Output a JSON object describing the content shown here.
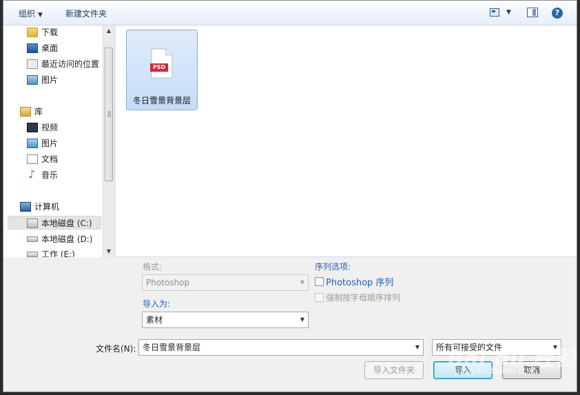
{
  "toolbar": {
    "organize_label": "组织",
    "new_folder_label": "新建文件夹"
  },
  "nav": {
    "items": [
      {
        "label": "下载"
      },
      {
        "label": "桌面"
      },
      {
        "label": "最近访问的位置"
      },
      {
        "label": "图片"
      },
      {
        "label": "库"
      },
      {
        "label": "视频"
      },
      {
        "label": "图片"
      },
      {
        "label": "文档"
      },
      {
        "label": "音乐"
      },
      {
        "label": "计算机"
      },
      {
        "label": "本地磁盘 (C:)"
      },
      {
        "label": "本地磁盘 (D:)"
      },
      {
        "label": "工作 (E:)"
      }
    ]
  },
  "files": {
    "items": [
      {
        "name": "冬日雪景背景层",
        "badge": "PSD"
      }
    ]
  },
  "options": {
    "format_label": "格式:",
    "format_value": "Photoshop",
    "import_as_label": "导入为:",
    "import_as_value": "素材",
    "sequence_label": "序列选项:",
    "sequence_checkbox_label": "Photoshop 序列",
    "alpha_order_label": "强制按字母顺序排列"
  },
  "footer": {
    "filename_label": "文件名(N):",
    "filename_value": "冬日雪景背景层",
    "filter_value": "所有可接受的文件",
    "import_folder_button": "导入文件夹",
    "import_button": "导入",
    "cancel_button": "取消"
  },
  "watermark": {
    "text": "Bai du 经验",
    "url": "jingyan.baidu.com"
  }
}
